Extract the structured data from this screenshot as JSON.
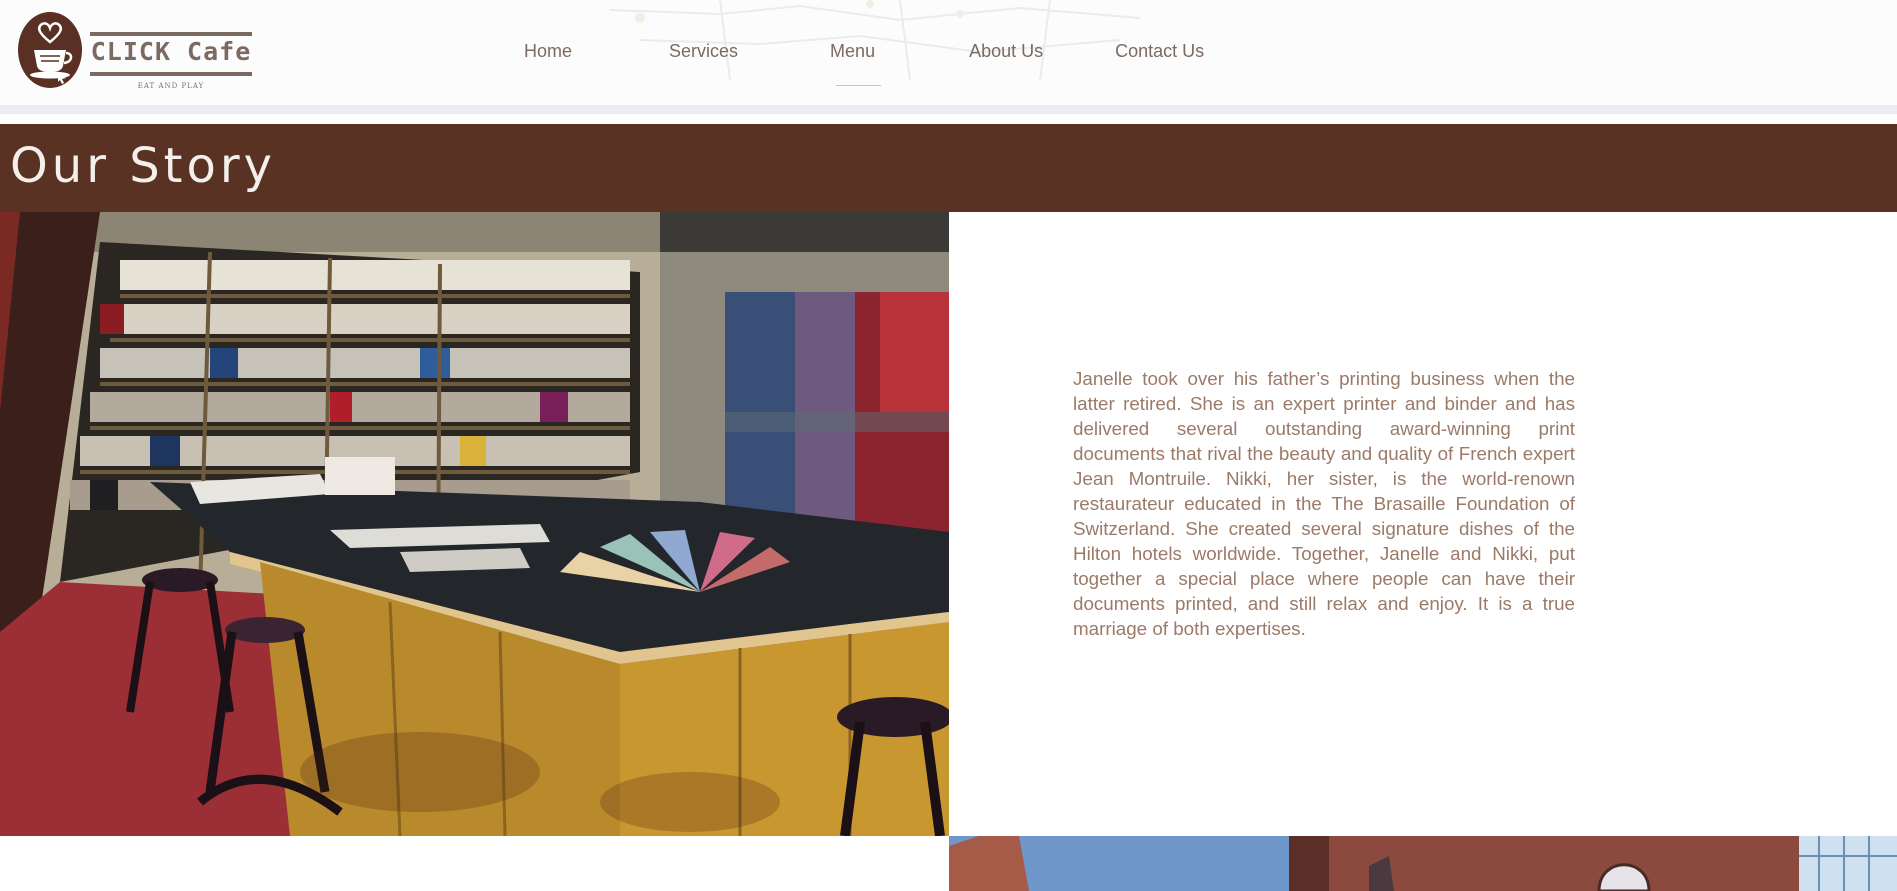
{
  "header": {
    "logo": {
      "title": "CLICK Cafe",
      "tagline": "EAT AND PLAY"
    },
    "nav": [
      {
        "label": "Home",
        "active": false
      },
      {
        "label": "Services",
        "active": false
      },
      {
        "label": "Menu",
        "active": true
      },
      {
        "label": "About Us",
        "active": false
      },
      {
        "label": "Contact Us",
        "active": false
      }
    ]
  },
  "banner": {
    "title": "Our Story"
  },
  "story": {
    "paragraph": "Janelle took over his father’s printing business when the latter retired. She is an expert printer and binder and has delivered several outstanding award-winning print documents that rival the beauty and quality of French expert Jean Montruile. Nikki, her sister, is the world-renown restaurateur educated in the The Brasaille Foundation of Switzerland. She created several signature dishes of the Hilton hotels worldwide. Together, Janelle and Nikki, put together a special place where people can have their documents printed, and still relax and enjoy. It is a true marriage of both expertises."
  },
  "colors": {
    "brand_brown": "#5a3223",
    "nav_text": "#7b6a62",
    "body_text": "#9b7a68",
    "header_bg": "#fdfcfc"
  }
}
